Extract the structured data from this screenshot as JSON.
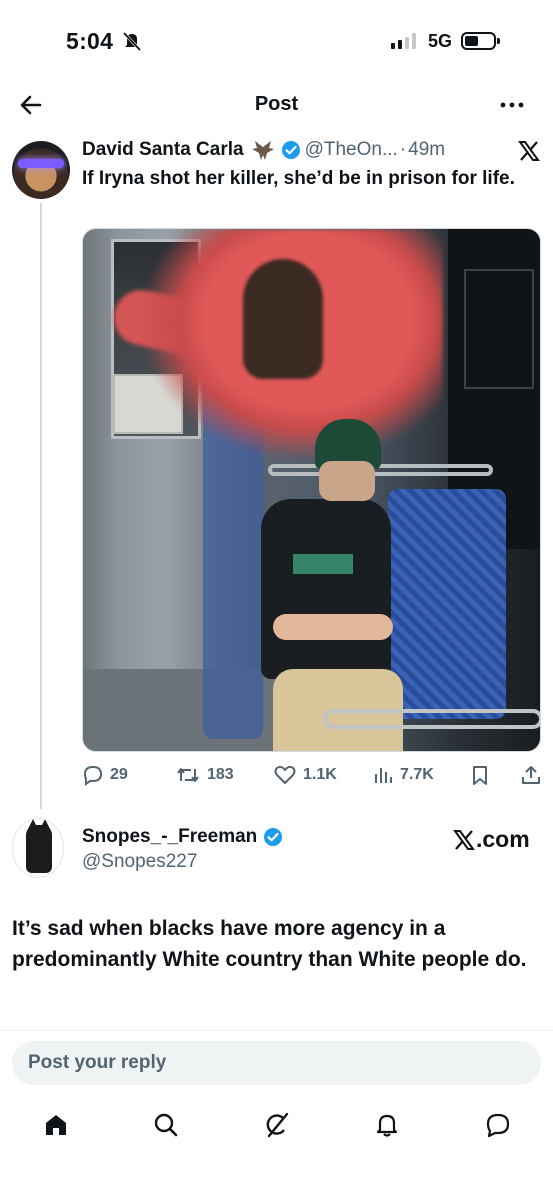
{
  "status_bar": {
    "time": "5:04",
    "network": "5G"
  },
  "nav": {
    "title": "Post"
  },
  "tweet": {
    "author_name": "David Santa Carla",
    "author_handle": "@TheOn...",
    "separator": "·",
    "time_ago": "49m",
    "text": "If Iryna shot her killer, she’d be in prison for life.",
    "stats": {
      "replies": "29",
      "reposts": "183",
      "likes": "1.1K",
      "views": "7.7K"
    }
  },
  "reply_author": {
    "name": "Snopes_-_Freeman",
    "handle": "@Snopes227",
    "source_label": ".com"
  },
  "reply_body": "It’s sad when blacks have more agency in a predominantly White country than White people do.",
  "composer": {
    "placeholder": "Post your reply"
  },
  "colors": {
    "verified": "#1d9bf0",
    "muted": "#536471",
    "text": "#0f1419"
  },
  "icons": [
    "back-arrow-icon",
    "more-icon",
    "bell-off-icon",
    "verified-badge-icon",
    "bat-emoji-icon",
    "x-logo-icon",
    "reply-icon",
    "repost-icon",
    "like-icon",
    "views-icon",
    "bookmark-icon",
    "share-icon",
    "home-icon",
    "search-icon",
    "grok-icon",
    "notifications-icon",
    "messages-icon"
  ]
}
